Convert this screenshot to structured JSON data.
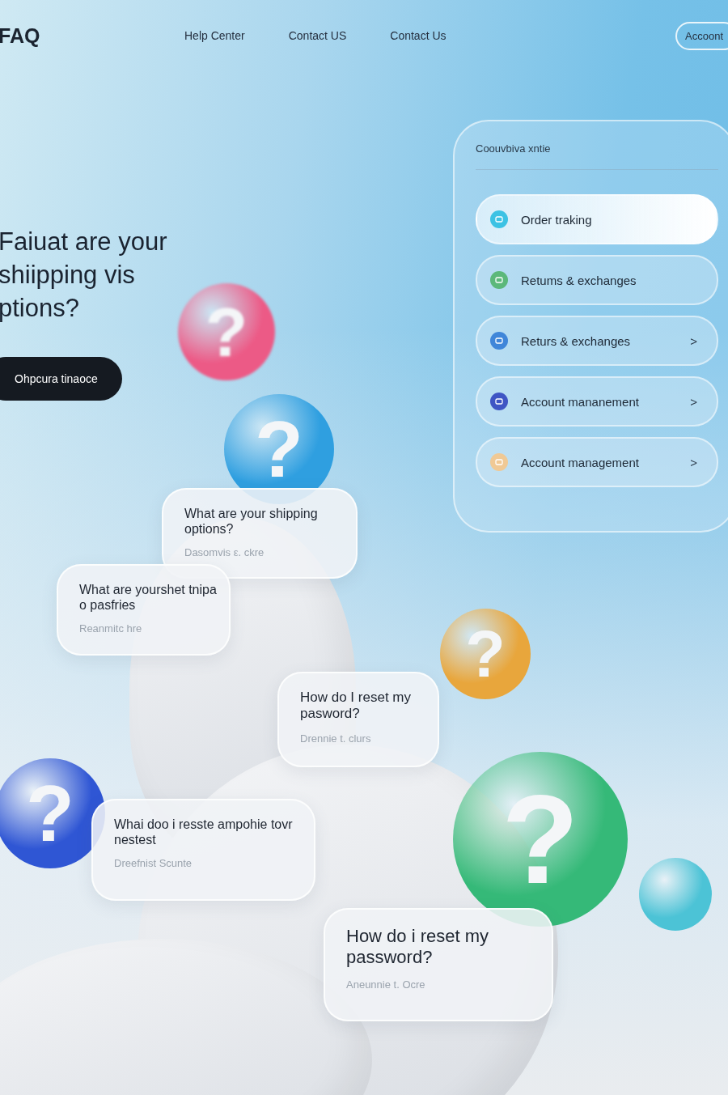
{
  "header": {
    "logo": "FAQ",
    "nav": [
      {
        "label": "Help Center"
      },
      {
        "label": "Contact US"
      },
      {
        "label": "Contact Us"
      }
    ],
    "account_button": "Accoont"
  },
  "hero": {
    "heading_lines": [
      "Faiuat are your",
      "shiipping vis",
      "ptions?"
    ],
    "button": "Ohpcura tinaoce"
  },
  "panel": {
    "title": "Coouvbiva xntie",
    "items": [
      {
        "label": "Order traking",
        "color": "#3cc2e4",
        "selected": true
      },
      {
        "label": "Retums & exchanges",
        "color": "#5cb87a",
        "selected": false
      },
      {
        "label": "Returs & exchanges",
        "color": "#3f86d9",
        "selected": false,
        "chevron": ">"
      },
      {
        "label": "Account mananement",
        "color": "#3f55c4",
        "selected": false,
        "chevron": ">"
      },
      {
        "label": "Account management",
        "color": "#f0c995",
        "selected": false,
        "chevron": ">"
      }
    ]
  },
  "spheres": [
    {
      "color": "#ec5a86",
      "symbol": "?",
      "blurred": true
    },
    {
      "color": "#2f9fe0",
      "symbol": "?",
      "blurred": false
    },
    {
      "color": "#e8a63c",
      "symbol": "?",
      "blurred": false
    },
    {
      "color": "#2f56d4",
      "symbol": "?",
      "blurred": false
    },
    {
      "color": "#35b978",
      "symbol": "?",
      "blurred": false
    },
    {
      "color": "#4cc3d6",
      "blurred": false
    }
  ],
  "faq_cards": [
    {
      "question": "What are your shipping options?",
      "meta": "Dasomvis ε. ckre"
    },
    {
      "question": "What are yourshet tnipa o pasfries",
      "meta": "Reanmitc hre"
    },
    {
      "question": "How do I reset my pasword?",
      "meta": "Drennie t. clurs"
    },
    {
      "question": "Whai doo i resste ampohie tovr nestest",
      "meta": "Dreefnist Scunte"
    },
    {
      "question": "How do i reset my password?",
      "meta": "Aneunnie t. Ocre"
    }
  ]
}
